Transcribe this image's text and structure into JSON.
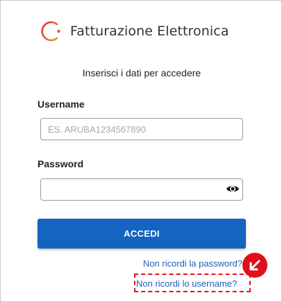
{
  "brand": {
    "name": "Fatturazione Elettronica",
    "colors": {
      "accent": "#e3572a",
      "primary": "#1565c0",
      "link": "#1e5fb4",
      "annotation": "#e0101a"
    }
  },
  "form": {
    "subtitle": "Inserisci i dati per accedere",
    "username": {
      "label": "Username",
      "placeholder": "ES. ARUBA1234567890",
      "value": ""
    },
    "password": {
      "label": "Password",
      "value": "",
      "toggle_icon": "eye-icon"
    },
    "submit_label": "ACCEDI"
  },
  "links": {
    "forgot_password": "Non ricordi la password?",
    "forgot_username": "Non ricordi lo username?"
  },
  "annotation": {
    "icon": "arrow-down-left-icon"
  }
}
